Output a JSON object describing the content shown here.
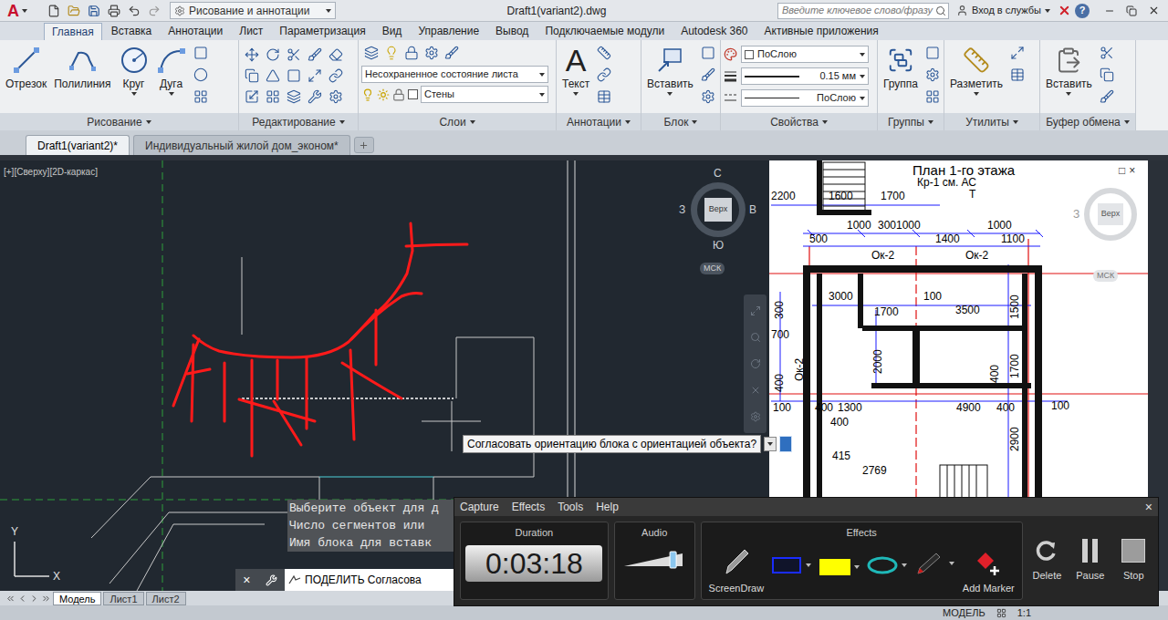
{
  "title_bar": {
    "logo": "A",
    "workspace": "Рисование и аннотации",
    "title": "Draft1(variant2).dwg",
    "search_placeholder": "Введите ключевое слово/фразу",
    "sign_in": "Вход в службы",
    "help": "?"
  },
  "ribbon_tabs": [
    {
      "label": "Главная",
      "selected": true
    },
    {
      "label": "Вставка",
      "selected": false
    },
    {
      "label": "Аннотации",
      "selected": false
    },
    {
      "label": "Лист",
      "selected": false
    },
    {
      "label": "Параметризация",
      "selected": false
    },
    {
      "label": "Вид",
      "selected": false
    },
    {
      "label": "Управление",
      "selected": false
    },
    {
      "label": "Вывод",
      "selected": false
    },
    {
      "label": "Подключаемые модули",
      "selected": false
    },
    {
      "label": "Autodesk 360",
      "selected": false
    },
    {
      "label": "Активные приложения",
      "selected": false
    }
  ],
  "ribbon": {
    "draw": {
      "label": "Рисование",
      "buttons": [
        {
          "kind": "line",
          "label": "Отрезок"
        },
        {
          "kind": "polyline",
          "label": "Полилиния"
        },
        {
          "kind": "circle",
          "label": "Круг"
        },
        {
          "kind": "arc",
          "label": "Дуга"
        }
      ]
    },
    "modify": {
      "label": "Редактирование"
    },
    "layers": {
      "label": "Слои",
      "state": "Несохраненное состояние листа",
      "layer": "Стены"
    },
    "annotation": {
      "label": "Аннотации",
      "text_icon": "A",
      "text_button": "Текст"
    },
    "block": {
      "label": "Блок",
      "button": "Вставить"
    },
    "properties": {
      "label": "Свойства",
      "color": "ПоСлою",
      "lineweight": "0.15 мм",
      "linetype": "ПоСлою"
    },
    "groups": {
      "label": "Группы",
      "button": "Группа"
    },
    "utilities": {
      "label": "Утилиты",
      "button": "Разметить"
    },
    "clipboard": {
      "label": "Буфер обмена",
      "button": "Вставить"
    }
  },
  "file_tabs": [
    {
      "label": "Draft1(variant2)*",
      "selected": true
    },
    {
      "label": "Индивидуальный жилой дом_эконом*",
      "selected": false
    }
  ],
  "viewport": {
    "label": "[+][Сверху][2D-каркас]",
    "viewcube": {
      "north": "С",
      "west": "З",
      "east": "В",
      "south": "Ю",
      "face": "Верх",
      "ucs": "МСК"
    },
    "ucs_icon": {
      "x": "X",
      "y": "Y"
    }
  },
  "plan_viewport": {
    "controls": [
      "□",
      "×"
    ],
    "viewcube": {
      "west": "З",
      "face": "Верх",
      "ucs": "МСК"
    },
    "labels": [
      "План 1-го этажа",
      "Кр-1 см. АС",
      "Т",
      "2200",
      "1600",
      "1700",
      "1000",
      "300",
      "1000",
      "1000",
      "500",
      "1400",
      "1100",
      "Ок-2",
      "Ок-2",
      "3000",
      "100",
      "3500",
      "1700",
      "1500",
      "300",
      "700",
      "2000",
      "1700",
      "400",
      "Ок-2",
      "400",
      "100",
      "400",
      "1300",
      "4900",
      "400",
      "100",
      "400",
      "2900",
      "415",
      "2769"
    ]
  },
  "tooltip": "Согласовать ориентацию блока с ориентацией объекта?",
  "command": {
    "history": [
      "Выберите объект для д",
      "Число сегментов или",
      "Имя блока для вставк"
    ],
    "close": "×",
    "input": "ПОДЕЛИТЬ Согласова"
  },
  "layout_tabs": [
    {
      "label": "Модель",
      "selected": true
    },
    {
      "label": "Лист1",
      "selected": false
    },
    {
      "label": "Лист2",
      "selected": false
    }
  ],
  "status_bar": {
    "mode": "МОДЕЛЬ",
    "scale": "1:1"
  },
  "recorder": {
    "menu": [
      "Capture",
      "Effects",
      "Tools",
      "Help"
    ],
    "close": "×",
    "duration_label": "Duration",
    "duration": "0:03:18",
    "audio_label": "Audio",
    "audio_level": 0.85,
    "effects_label": "Effects",
    "tools": [
      {
        "kind": "screendraw",
        "label": "ScreenDraw"
      },
      {
        "kind": "rectangle",
        "color": "#1a2cff"
      },
      {
        "kind": "highlight",
        "color": "#ffff00"
      },
      {
        "kind": "ellipse",
        "color": "#1fb8b8"
      },
      {
        "kind": "pen",
        "color": "#d01818"
      }
    ],
    "add_marker": "Add Marker",
    "buttons": [
      {
        "kind": "delete",
        "label": "Delete"
      },
      {
        "kind": "pause",
        "label": "Pause"
      },
      {
        "kind": "stop",
        "label": "Stop"
      }
    ]
  }
}
